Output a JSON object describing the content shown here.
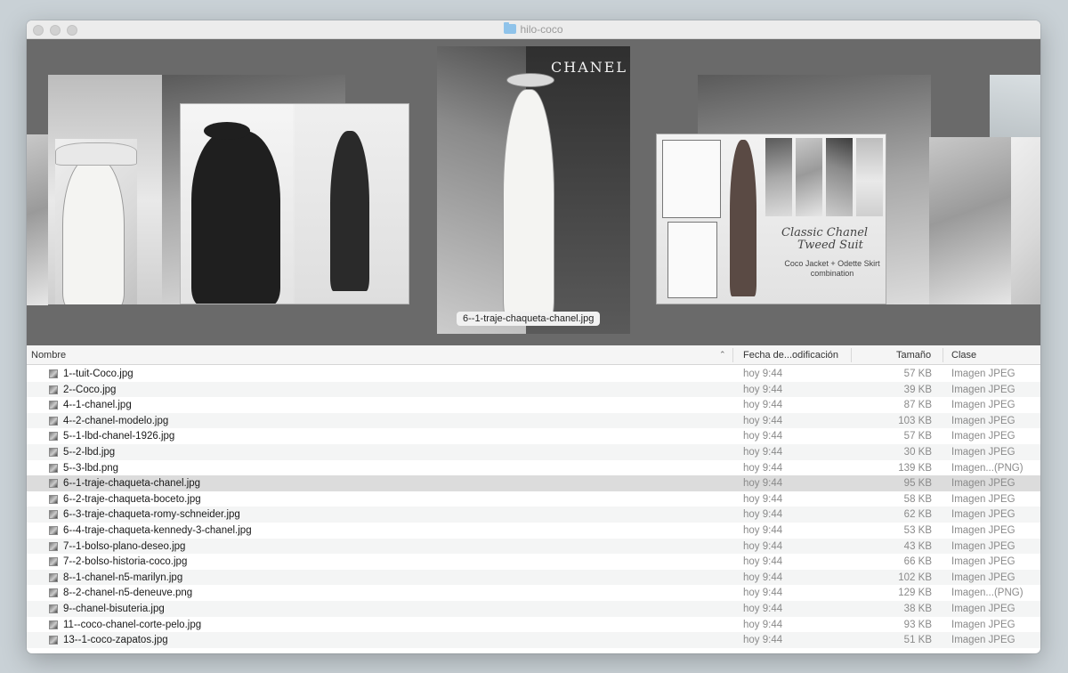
{
  "window": {
    "title": "hilo-coco"
  },
  "gallery": {
    "brand_text": "CHANEL",
    "suit_title_line1": "Classic Chanel",
    "suit_title_line2": "Tweed Suit",
    "suit_sub_line1": "Coco Jacket + Odette Skirt",
    "suit_sub_line2": "combination",
    "caption": "6--1-traje-chaqueta-chanel.jpg"
  },
  "columns": {
    "name": "Nombre",
    "date": "Fecha de...odificación",
    "size": "Tamaño",
    "kind": "Clase"
  },
  "files": [
    {
      "name": "1--tuit-Coco.jpg",
      "date": "hoy 9:44",
      "size": "57 KB",
      "kind": "Imagen JPEG"
    },
    {
      "name": "2--Coco.jpg",
      "date": "hoy 9:44",
      "size": "39 KB",
      "kind": "Imagen JPEG"
    },
    {
      "name": "4--1-chanel.jpg",
      "date": "hoy 9:44",
      "size": "87 KB",
      "kind": "Imagen JPEG"
    },
    {
      "name": "4--2-chanel-modelo.jpg",
      "date": "hoy 9:44",
      "size": "103 KB",
      "kind": "Imagen JPEG"
    },
    {
      "name": "5--1-lbd-chanel-1926.jpg",
      "date": "hoy 9:44",
      "size": "57 KB",
      "kind": "Imagen JPEG"
    },
    {
      "name": "5--2-lbd.jpg",
      "date": "hoy 9:44",
      "size": "30 KB",
      "kind": "Imagen JPEG"
    },
    {
      "name": "5--3-lbd.png",
      "date": "hoy 9:44",
      "size": "139 KB",
      "kind": "Imagen...(PNG)"
    },
    {
      "name": "6--1-traje-chaqueta-chanel.jpg",
      "date": "hoy 9:44",
      "size": "95 KB",
      "kind": "Imagen JPEG"
    },
    {
      "name": "6--2-traje-chaqueta-boceto.jpg",
      "date": "hoy 9:44",
      "size": "58 KB",
      "kind": "Imagen JPEG"
    },
    {
      "name": "6--3-traje-chaqueta-romy-schneider.jpg",
      "date": "hoy 9:44",
      "size": "62 KB",
      "kind": "Imagen JPEG"
    },
    {
      "name": "6--4-traje-chaqueta-kennedy-3-chanel.jpg",
      "date": "hoy 9:44",
      "size": "53 KB",
      "kind": "Imagen JPEG"
    },
    {
      "name": "7--1-bolso-plano-deseo.jpg",
      "date": "hoy 9:44",
      "size": "43 KB",
      "kind": "Imagen JPEG"
    },
    {
      "name": "7--2-bolso-historia-coco.jpg",
      "date": "hoy 9:44",
      "size": "66 KB",
      "kind": "Imagen JPEG"
    },
    {
      "name": "8--1-chanel-n5-marilyn.jpg",
      "date": "hoy 9:44",
      "size": "102 KB",
      "kind": "Imagen JPEG"
    },
    {
      "name": "8--2-chanel-n5-deneuve.png",
      "date": "hoy 9:44",
      "size": "129 KB",
      "kind": "Imagen...(PNG)"
    },
    {
      "name": "9--chanel-bisuteria.jpg",
      "date": "hoy 9:44",
      "size": "38 KB",
      "kind": "Imagen JPEG"
    },
    {
      "name": "11--coco-chanel-corte-pelo.jpg",
      "date": "hoy 9:44",
      "size": "93 KB",
      "kind": "Imagen JPEG"
    },
    {
      "name": "13--1-coco-zapatos.jpg",
      "date": "hoy 9:44",
      "size": "51 KB",
      "kind": "Imagen JPEG"
    }
  ]
}
